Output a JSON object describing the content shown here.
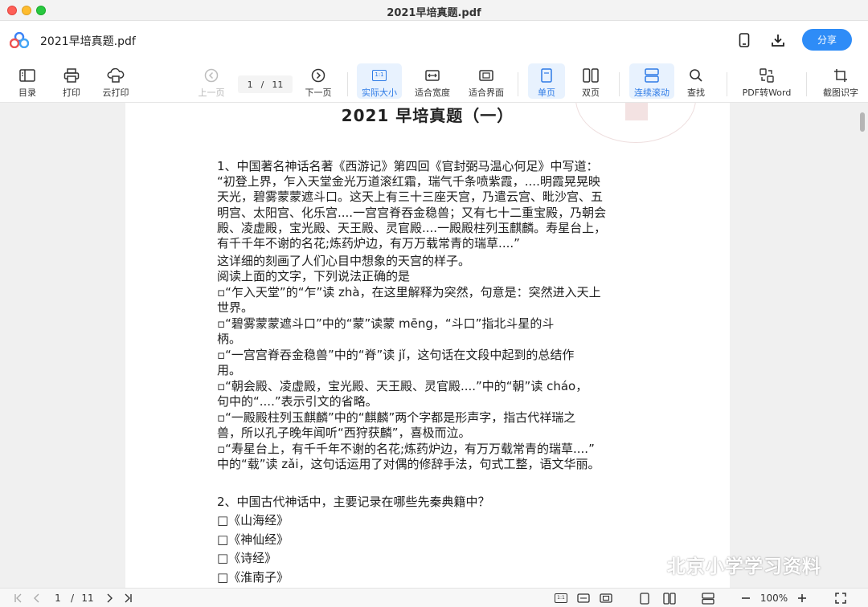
{
  "window": {
    "title": "2021早培真题.pdf"
  },
  "header": {
    "doc_title": "2021早培真题.pdf",
    "share_label": "分享",
    "icons": {
      "mobile": "mobile-phone-icon",
      "download": "download-icon"
    },
    "accent": "#2e8cf7"
  },
  "toolbar": {
    "toc": "目录",
    "print": "打印",
    "cloud_print": "云打印",
    "prev_page": "上一页",
    "current_page": "1",
    "page_sep": "/",
    "total_pages": "11",
    "next_page": "下一页",
    "actual_size": "实际大小",
    "actual_size_icon_text": "1:1",
    "fit_width": "适合宽度",
    "fit_page": "适合界面",
    "single_page": "单页",
    "double_page": "双页",
    "continuous": "连续滚动",
    "find": "查找",
    "pdf_to_word": "PDF转Word",
    "ocr": "截图识字"
  },
  "document": {
    "heading": "2021 早培真题（一）",
    "lines": [
      "1、中国著名神话名著《西游记》第四回《官封弼马温心何足》中写道：",
      "“初登上界，乍入天堂金光万道滚红霜，瑞气千条喷紫霞，....明霞晃晃映",
      "天光，碧雾蒙蒙遮斗口。这天上有三十三座天宫，乃遣云宫、毗沙宫、五",
      "明宫、太阳宫、化乐宫....一宫宫脊吞金稳兽；又有七十二重宝殿，乃朝会",
      "殿、凌虚殿，宝光殿、天王殿、灵官殿....一殿殿柱列玉麒麟。寿星台上，",
      "有千千年不谢的名花;炼药炉边，有万万载常青的瑞草....”",
      "这详细的刻画了人们心目中想象的天宫的样子。",
      "阅读上面的文字，下列说法正确的是",
      "▫“乍入天堂”的“乍”读 zhà，在这里解释为突然，句意是：突然进入天上",
      "世界。",
      "▫“碧雾蒙蒙遮斗口”中的“蒙”读蒙 mēng，“斗口”指北斗星的斗",
      "柄。",
      "▫“一宫宫脊吞金稳兽”中的“脊”读 jǐ，这句话在文段中起到的总结作",
      "用。",
      "▫“朝会殿、凌虚殿，宝光殿、天王殿、灵官殿....”中的“朝”读 cháo，",
      "句中的“....”表示引文的省略。",
      "▫“一殿殿柱列玉麒麟”中的“麒麟”两个字都是形声字，指古代祥瑞之",
      "兽，所以孔子晚年闻听“西狩获麟”，喜极而泣。",
      "▫“寿星台上，有千千年不谢的名花;炼药炉边，有万万载常青的瑞草....”",
      "中的“载”读 zǎi，这句话运用了对偶的修辞手法，句式工整，语文华丽。",
      "2、中国古代神话中，主要记录在哪些先秦典籍中？",
      "□《山海经》",
      "□《神仙经》",
      "□《诗经》",
      "□《淮南子》"
    ]
  },
  "watermark": {
    "text": "北京小学学习资料",
    "icon": "wechat-icon"
  },
  "statusbar": {
    "current_page": "1",
    "page_sep": "/",
    "total_pages": "11",
    "fit_actual_text": "1:1",
    "zoom": "100%"
  }
}
